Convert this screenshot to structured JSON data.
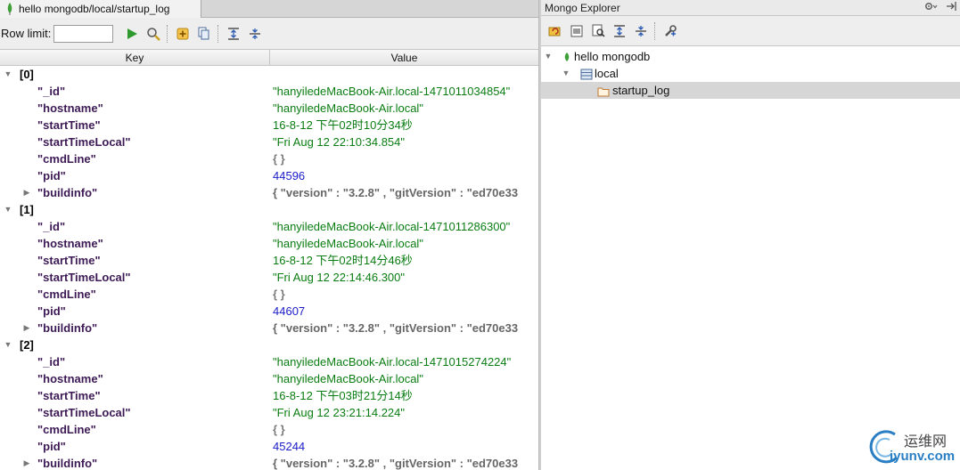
{
  "editor": {
    "tab_title": "hello mongodb/local/startup_log",
    "row_limit_label": "Row limit:",
    "row_limit_value": "",
    "columns": {
      "key": "Key",
      "value": "Value"
    },
    "documents": [
      {
        "index": "[0]",
        "fields": [
          {
            "key": "\"_id\"",
            "value": "\"hanyiledeMacBook-Air.local-1471011034854\"",
            "kind": "str"
          },
          {
            "key": "\"hostname\"",
            "value": "\"hanyiledeMacBook-Air.local\"",
            "kind": "str"
          },
          {
            "key": "\"startTime\"",
            "value": "16-8-12 下午02时10分34秒",
            "kind": "date"
          },
          {
            "key": "\"startTimeLocal\"",
            "value": "\"Fri Aug 12 22:10:34.854\"",
            "kind": "str"
          },
          {
            "key": "\"cmdLine\"",
            "value": "{ }",
            "kind": "obj"
          },
          {
            "key": "\"pid\"",
            "value": "44596",
            "kind": "num"
          },
          {
            "key": "\"buildinfo\"",
            "value": "{ \"version\" : \"3.2.8\" , \"gitVersion\" : \"ed70e33",
            "kind": "sub"
          }
        ]
      },
      {
        "index": "[1]",
        "fields": [
          {
            "key": "\"_id\"",
            "value": "\"hanyiledeMacBook-Air.local-1471011286300\"",
            "kind": "str"
          },
          {
            "key": "\"hostname\"",
            "value": "\"hanyiledeMacBook-Air.local\"",
            "kind": "str"
          },
          {
            "key": "\"startTime\"",
            "value": "16-8-12 下午02时14分46秒",
            "kind": "date"
          },
          {
            "key": "\"startTimeLocal\"",
            "value": "\"Fri Aug 12 22:14:46.300\"",
            "kind": "str"
          },
          {
            "key": "\"cmdLine\"",
            "value": "{ }",
            "kind": "obj"
          },
          {
            "key": "\"pid\"",
            "value": "44607",
            "kind": "num"
          },
          {
            "key": "\"buildinfo\"",
            "value": "{ \"version\" : \"3.2.8\" , \"gitVersion\" : \"ed70e33",
            "kind": "sub"
          }
        ]
      },
      {
        "index": "[2]",
        "fields": [
          {
            "key": "\"_id\"",
            "value": "\"hanyiledeMacBook-Air.local-1471015274224\"",
            "kind": "str"
          },
          {
            "key": "\"hostname\"",
            "value": "\"hanyiledeMacBook-Air.local\"",
            "kind": "str"
          },
          {
            "key": "\"startTime\"",
            "value": "16-8-12 下午03时21分14秒",
            "kind": "date"
          },
          {
            "key": "\"startTimeLocal\"",
            "value": "\"Fri Aug 12 23:21:14.224\"",
            "kind": "str"
          },
          {
            "key": "\"cmdLine\"",
            "value": "{ }",
            "kind": "obj"
          },
          {
            "key": "\"pid\"",
            "value": "45244",
            "kind": "num"
          },
          {
            "key": "\"buildinfo\"",
            "value": "{ \"version\" : \"3.2.8\" , \"gitVersion\" : \"ed70e33",
            "kind": "sub"
          }
        ]
      }
    ]
  },
  "explorer": {
    "title": "Mongo Explorer",
    "tree": {
      "server": "hello mongodb",
      "database": "local",
      "collection": "startup_log"
    }
  },
  "watermark": {
    "cn": "运维网",
    "en": "iyunv.com"
  },
  "colors": {
    "string": "#0a7d12",
    "number": "#1c1cc8",
    "key": "#3d1a55",
    "selection": "#d6d6d6"
  }
}
